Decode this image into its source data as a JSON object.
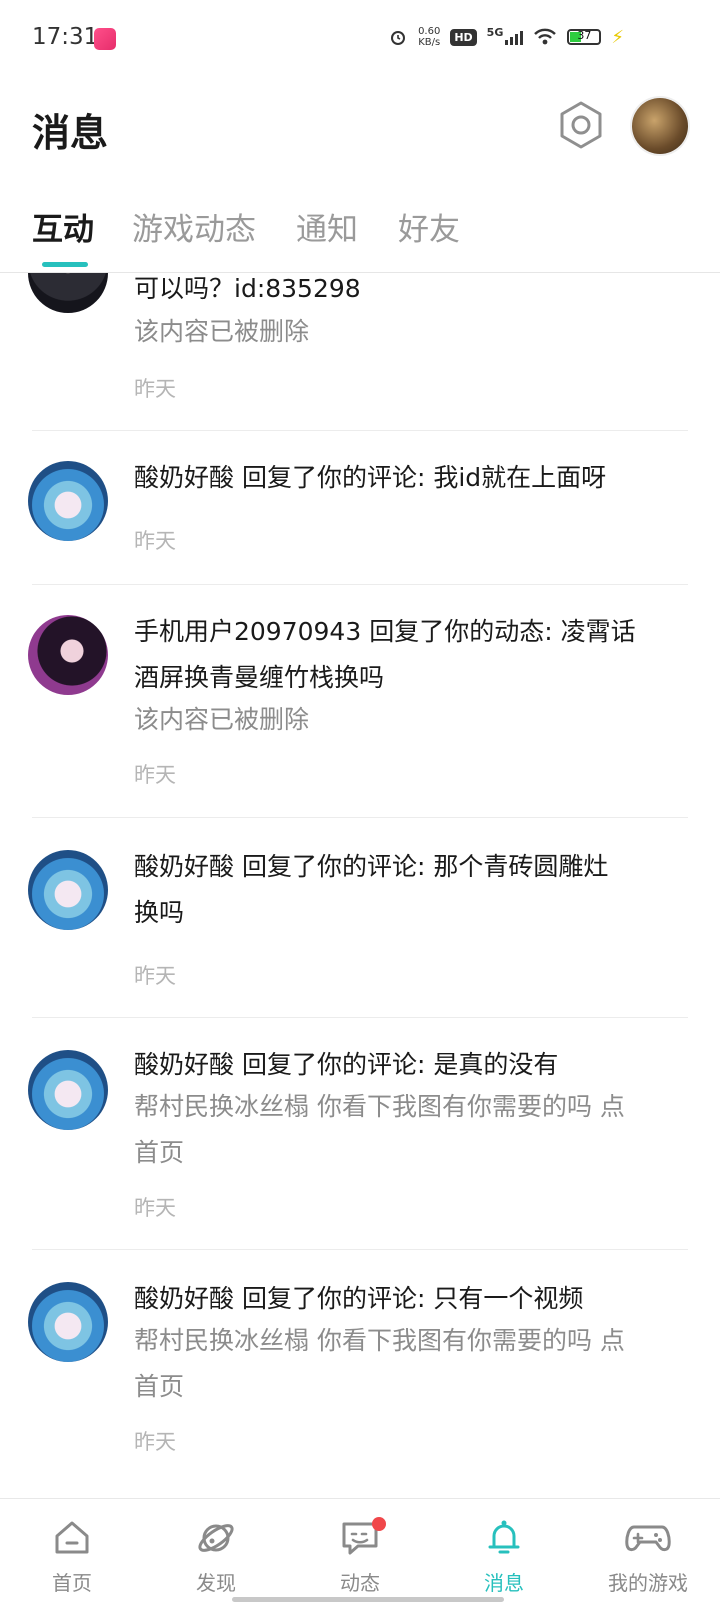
{
  "status_bar": {
    "time": "17:31",
    "net_speed": "0.60",
    "net_unit": "KB/s",
    "hd": "HD",
    "network": "5G",
    "battery": "37"
  },
  "header": {
    "title": "消息"
  },
  "tabs": [
    {
      "label": "互动"
    },
    {
      "label": "游戏动态"
    },
    {
      "label": "通知"
    },
    {
      "label": "好友"
    }
  ],
  "messages": [
    {
      "text": "可以吗？id:835298",
      "sub": "该内容已被删除",
      "time": "昨天"
    },
    {
      "text": "酸奶好酸 回复了你的评论: 我id就在上面呀",
      "sub": "",
      "time": "昨天"
    },
    {
      "text_line1": "手机用户20970943 回复了你的动态: 凌霄话",
      "text_line2": "酒屏换青曼缠竹栈换吗",
      "sub": "该内容已被删除",
      "time": "昨天"
    },
    {
      "text_line1": "酸奶好酸 回复了你的评论: 那个青砖圆雕灶",
      "text_line2": "换吗",
      "sub": "",
      "time": "昨天"
    },
    {
      "text": "酸奶好酸 回复了你的评论: 是真的没有",
      "sub_line1": "帮村民换冰丝榻 你看下我图有你需要的吗 点",
      "sub_line2": "首页",
      "time": "昨天"
    },
    {
      "text": "酸奶好酸 回复了你的评论: 只有一个视频",
      "sub_line1": "帮村民换冰丝榻 你看下我图有你需要的吗 点",
      "sub_line2": "首页",
      "time": "昨天"
    }
  ],
  "bottom_nav": [
    {
      "label": "首页",
      "icon": "home-icon"
    },
    {
      "label": "发现",
      "icon": "planet-icon"
    },
    {
      "label": "动态",
      "icon": "chat-icon"
    },
    {
      "label": "消息",
      "icon": "bell-icon"
    },
    {
      "label": "我的游戏",
      "icon": "gamepad-icon"
    }
  ],
  "colors": {
    "accent": "#27c0bd",
    "badge": "#f0474a"
  }
}
